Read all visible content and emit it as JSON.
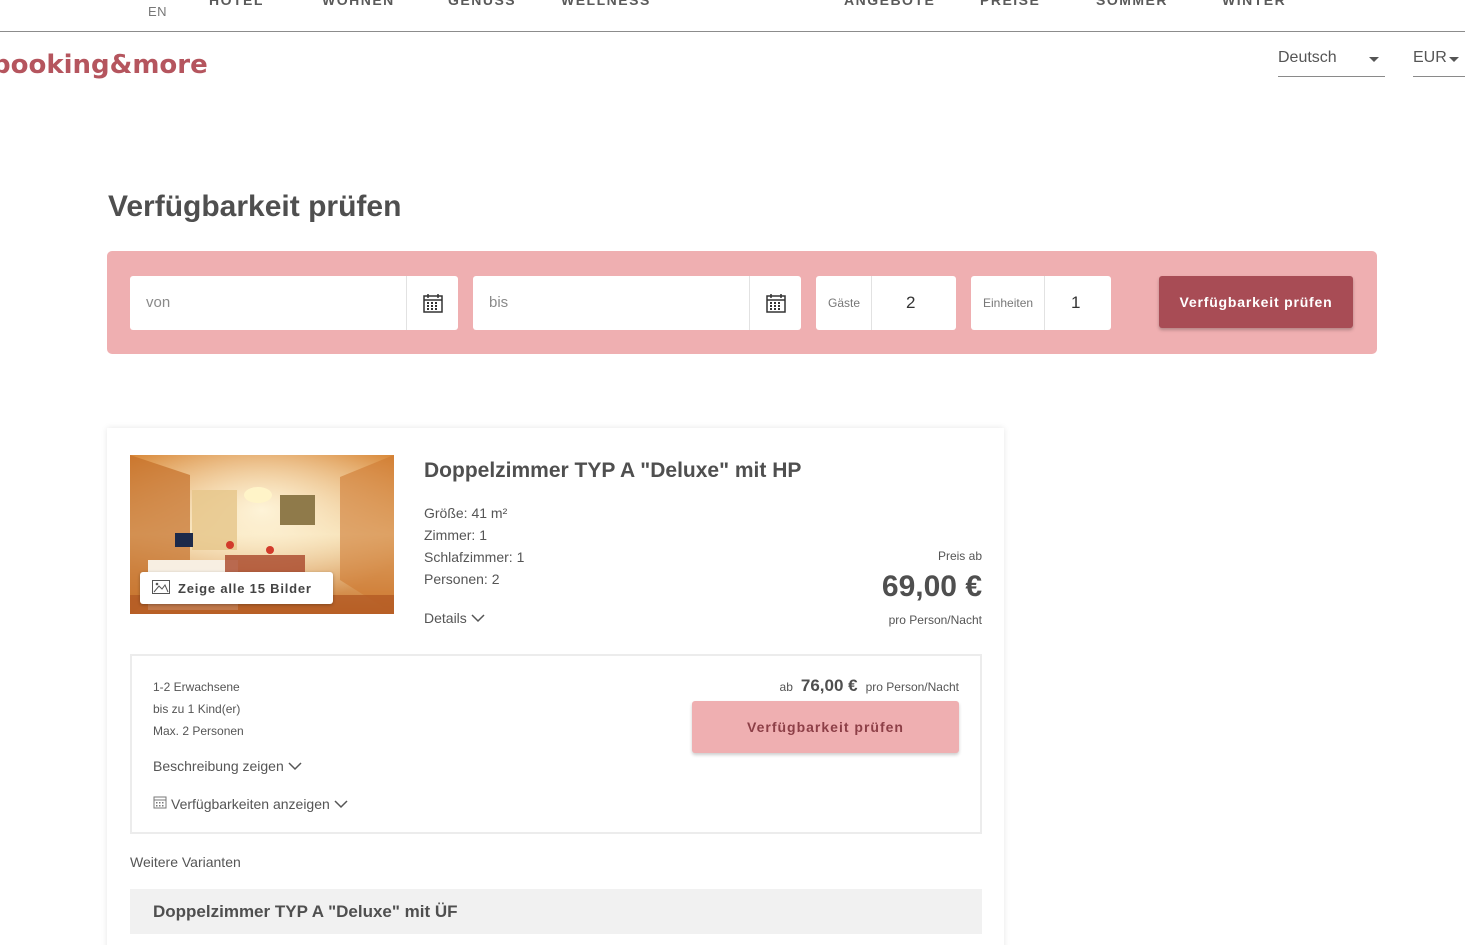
{
  "topnav": {
    "lang": "EN",
    "items": [
      "HOTEL",
      "WOHNEN",
      "GENUSS",
      "WELLNESS",
      "ANGEBOTE",
      "PREISE",
      "SOMMER",
      "WINTER"
    ]
  },
  "header": {
    "logo": "booking&more",
    "language": "Deutsch",
    "currency": "EUR"
  },
  "page_title": "Verfügbarkeit prüfen",
  "search": {
    "from_placeholder": "von",
    "to_placeholder": "bis",
    "guests_label": "Gäste",
    "guests_value": "2",
    "units_label": "Einheiten",
    "units_value": "1",
    "submit_label": "Verfügbarkeit prüfen"
  },
  "room": {
    "title": "Doppelzimmer TYP A \"Deluxe\" mit HP",
    "photos_button": "Zeige alle 15 Bilder",
    "specs": [
      "Größe: 41 m²",
      "Zimmer: 1",
      "Schlafzimmer: 1",
      "Personen: 2"
    ],
    "details_label": "Details",
    "price_from_label": "Preis ab",
    "price": "69,00 €",
    "price_unit": "pro Person/Nacht",
    "variant": {
      "occupancy": [
        "1-2 Erwachsene",
        "bis zu 1 Kind(er)",
        "Max. 2 Personen"
      ],
      "description_toggle": "Beschreibung zeigen",
      "availability_toggle": "Verfügbarkeiten anzeigen",
      "price_prefix": "ab",
      "price": "76,00 €",
      "price_unit": "pro Person/Nacht",
      "button_label": "Verfügbarkeit prüfen"
    },
    "more_variants_label": "Weitere Varianten",
    "next_variant_title": "Doppelzimmer TYP A \"Deluxe\" mit ÜF"
  },
  "colors": {
    "brand": "#b5555e",
    "search_bg": "#efafb1",
    "button_dark": "#a84c55"
  }
}
